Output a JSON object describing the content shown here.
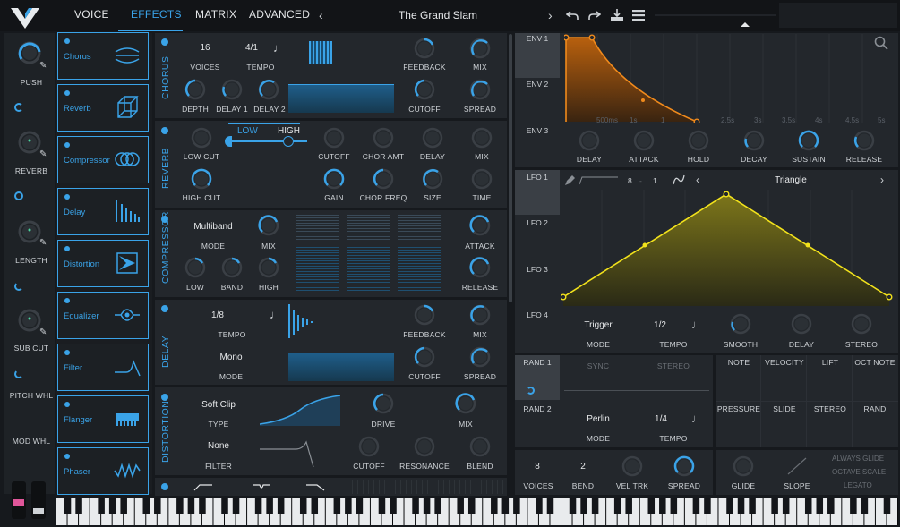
{
  "nav": {
    "tabs": [
      "VOICE",
      "EFFECTS",
      "MATRIX",
      "ADVANCED"
    ],
    "active_tab": "EFFECTS",
    "preset_name": "The Grand Slam"
  },
  "left": {
    "push": "PUSH",
    "reverb": "REVERB",
    "length": "LENGTH",
    "sub_cut": "SUB CUT",
    "pitch_whl": "PITCH WHL",
    "mod_whl": "MOD WHL"
  },
  "fx_list": [
    "Chorus",
    "Reverb",
    "Compressor",
    "Delay",
    "Distortion",
    "Equalizer",
    "Filter",
    "Flanger",
    "Phaser"
  ],
  "chorus": {
    "title": "CHORUS",
    "voices_val": "16",
    "voices": "VOICES",
    "tempo_val": "4/1",
    "tempo": "TEMPO",
    "feedback": "FEEDBACK",
    "mix": "MIX",
    "depth": "DEPTH",
    "delay1": "DELAY 1",
    "delay2": "DELAY 2",
    "cutoff": "CUTOFF",
    "spread": "SPREAD"
  },
  "reverb": {
    "title": "REVERB",
    "low": "LOW",
    "high": "HIGH",
    "low_cut": "LOW CUT",
    "high_cut": "HIGH CUT",
    "cutoff": "CUTOFF",
    "chor_amt": "CHOR AMT",
    "delay": "DELAY",
    "mix": "MIX",
    "gain": "GAIN",
    "chor_freq": "CHOR FREQ",
    "size": "SIZE",
    "time": "TIME"
  },
  "compressor": {
    "title": "COMPRESSOR",
    "mode_val": "Multiband",
    "mode": "MODE",
    "mix": "MIX",
    "low": "LOW",
    "band": "BAND",
    "high": "HIGH",
    "attack": "ATTACK",
    "release": "RELEASE"
  },
  "delay": {
    "title": "DELAY",
    "tempo_val": "1/8",
    "tempo": "TEMPO",
    "mode_val": "Mono",
    "mode": "MODE",
    "feedback": "FEEDBACK",
    "mix": "MIX",
    "cutoff": "CUTOFF",
    "spread": "SPREAD"
  },
  "distortion": {
    "title": "DISTORTION",
    "type_val": "Soft Clip",
    "type": "TYPE",
    "filter_val": "None",
    "filter": "FILTER",
    "drive": "DRIVE",
    "mix": "MIX",
    "cutoff": "CUTOFF",
    "resonance": "RESONANCE",
    "blend": "BLEND"
  },
  "env": {
    "tabs": [
      "ENV 1",
      "ENV 2",
      "ENV 3"
    ],
    "time_labels": [
      "500ms",
      "1s",
      "1",
      "2.5s",
      "3s",
      "3.5s",
      "4s",
      "4.5s",
      "5s"
    ],
    "knobs": [
      "DELAY",
      "ATTACK",
      "HOLD",
      "DECAY",
      "SUSTAIN",
      "RELEASE"
    ]
  },
  "lfo": {
    "tabs": [
      "LFO 1",
      "LFO 2",
      "LFO 3",
      "LFO 4"
    ],
    "grid_x": "8",
    "grid_y": "1",
    "shape": "Triangle",
    "trigger": "Trigger",
    "mode": "MODE",
    "tempo_val": "1/2",
    "tempo": "TEMPO",
    "smooth": "SMOOTH",
    "delay": "DELAY",
    "stereo": "STEREO"
  },
  "rand": {
    "tabs": [
      "RAND 1",
      "RAND 2"
    ],
    "sync": "SYNC",
    "stereo": "STEREO",
    "mode_val": "Perlin",
    "mode": "MODE",
    "tempo_val": "1/4",
    "tempo": "TEMPO"
  },
  "sources": {
    "row1": [
      "NOTE",
      "VELOCITY",
      "LIFT",
      "OCT NOTE"
    ],
    "row2": [
      "PRESSURE",
      "SLIDE",
      "STEREO",
      "RAND"
    ]
  },
  "voice": {
    "voices_val": "8",
    "voices": "VOICES",
    "bend_val": "2",
    "bend": "BEND",
    "vel_trk": "VEL TRK",
    "spread": "SPREAD",
    "glide": "GLIDE",
    "slope": "SLOPE",
    "always_glide": "ALWAYS GLIDE",
    "octave_scale": "OCTAVE SCALE",
    "legato": "LEGATO"
  },
  "colors": {
    "accent": "#3aa3e8",
    "env": "#f08a1c",
    "lfo": "#f2e21c",
    "bg": "#16191d",
    "panel": "#23272c"
  }
}
